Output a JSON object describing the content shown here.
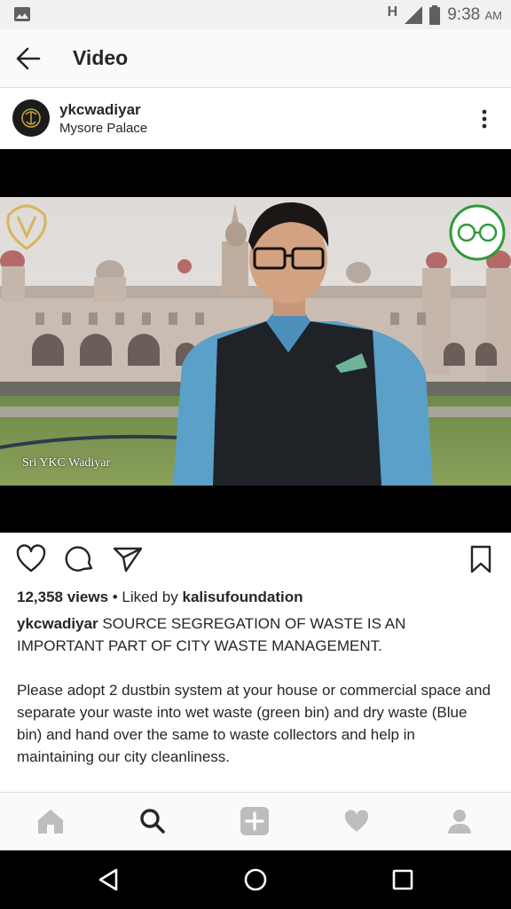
{
  "status_bar": {
    "network_indicator": "H",
    "time": "9:38",
    "ampm": "AM",
    "icons": [
      "gallery-icon",
      "signal-icon",
      "battery-icon"
    ]
  },
  "header": {
    "title": "Video",
    "back_icon": "arrow-left-icon"
  },
  "post": {
    "username": "ykcwadiyar",
    "location": "Mysore Palace",
    "more_icon": "more-vertical-icon",
    "video": {
      "watermark": "Sri YKC Wadiyar"
    },
    "views": "12,358 views",
    "liked_by_prefix": " • Liked by ",
    "liked_by_user": "kalisufoundation",
    "caption_user": "ykcwadiyar",
    "caption_first": " SOURCE SEGREGATION OF WASTE IS AN IMPORTANT PART OF CITY WASTE MANAGEMENT.",
    "caption_second": "Please adopt 2 dustbin system at your house or commercial space and separate your waste into wet waste (green bin) and dry waste (Blue bin) and hand over the same to waste collectors and help in maintaining our city cleanliness."
  },
  "actions": [
    "heart-icon",
    "comment-icon",
    "share-icon",
    "bookmark-icon"
  ],
  "bottom_nav": [
    "home-icon",
    "search-icon",
    "add-icon",
    "activity-heart-icon",
    "profile-icon"
  ],
  "system_nav": [
    "back-triangle-icon",
    "home-circle-icon",
    "recents-square-icon"
  ],
  "colors": {
    "text": "#262626",
    "nav_inactive": "#bdbdbd",
    "header_bg": "#fafafa"
  }
}
